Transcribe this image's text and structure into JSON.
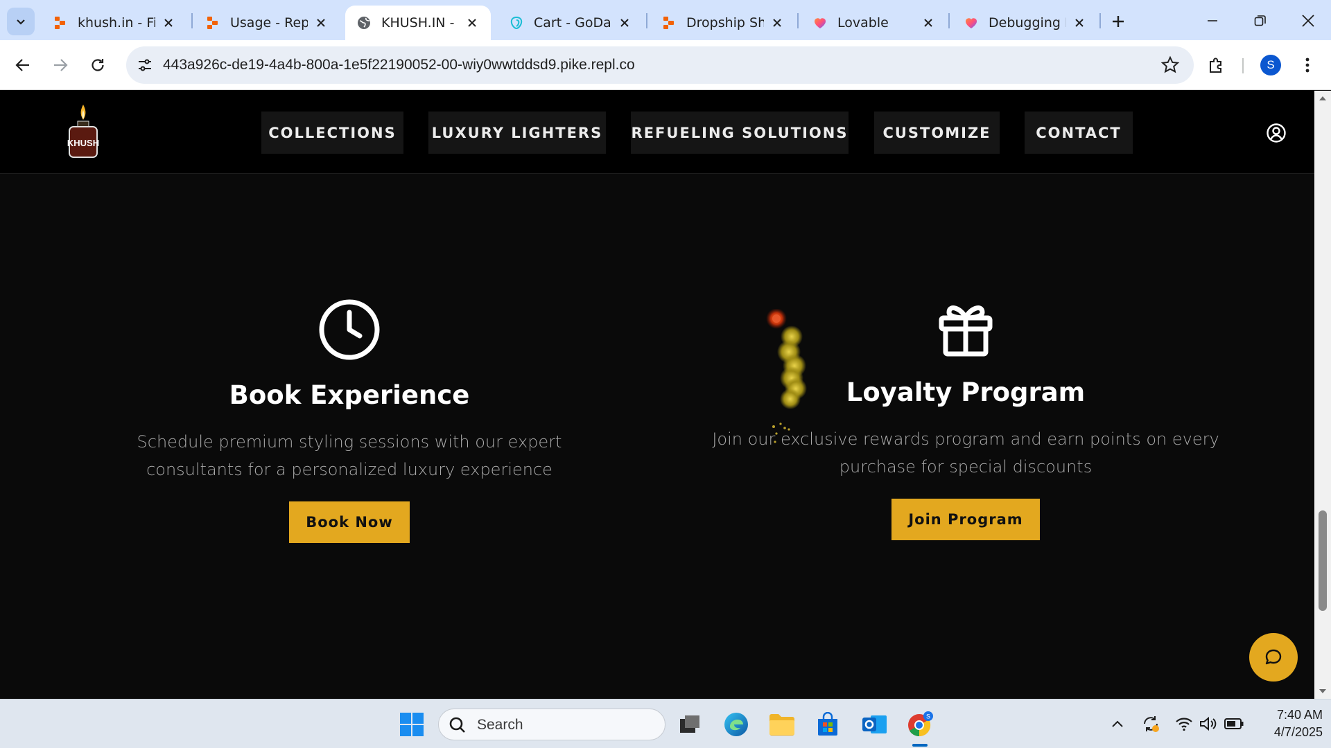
{
  "browser": {
    "tabs": [
      {
        "title": "khush.in - Fina",
        "favicon": "replit-icon",
        "active": false
      },
      {
        "title": "Usage - Replit",
        "favicon": "replit-icon",
        "active": false
      },
      {
        "title": "KHUSH.IN - Lu",
        "favicon": "globe-icon",
        "active": true
      },
      {
        "title": "Cart - GoDadd",
        "favicon": "godaddy-icon",
        "active": false
      },
      {
        "title": "Dropship Shop",
        "favicon": "replit-icon",
        "active": false
      },
      {
        "title": "Lovable",
        "favicon": "lovable-heart-icon",
        "active": false
      },
      {
        "title": "Debugging Pr",
        "favicon": "lovable-heart-icon",
        "active": false
      }
    ],
    "url": "443a926c-de19-4a4b-800a-1e5f22190052-00-wiy0wwtddsd9.pike.repl.co",
    "profile_initial": "S"
  },
  "site": {
    "nav": [
      "COLLECTIONS",
      "LUXURY LIGHTERS",
      "REFUELING SOLUTIONS",
      "CUSTOMIZE",
      "CONTACT"
    ],
    "logo_text": "KHUSH",
    "features": [
      {
        "icon": "clock-icon",
        "title": "Book Experience",
        "description": "Schedule premium styling sessions with our expert consultants for a personalized luxury experience",
        "button": "Book Now"
      },
      {
        "icon": "gift-icon",
        "title": "Loyalty Program",
        "description": "Join our exclusive rewards program and earn points on every purchase for special discounts",
        "button": "Join Program"
      }
    ],
    "accent_color": "#e3a81f"
  },
  "taskbar": {
    "search_label": "Search",
    "time": "7:40 AM",
    "date": "4/7/2025"
  }
}
